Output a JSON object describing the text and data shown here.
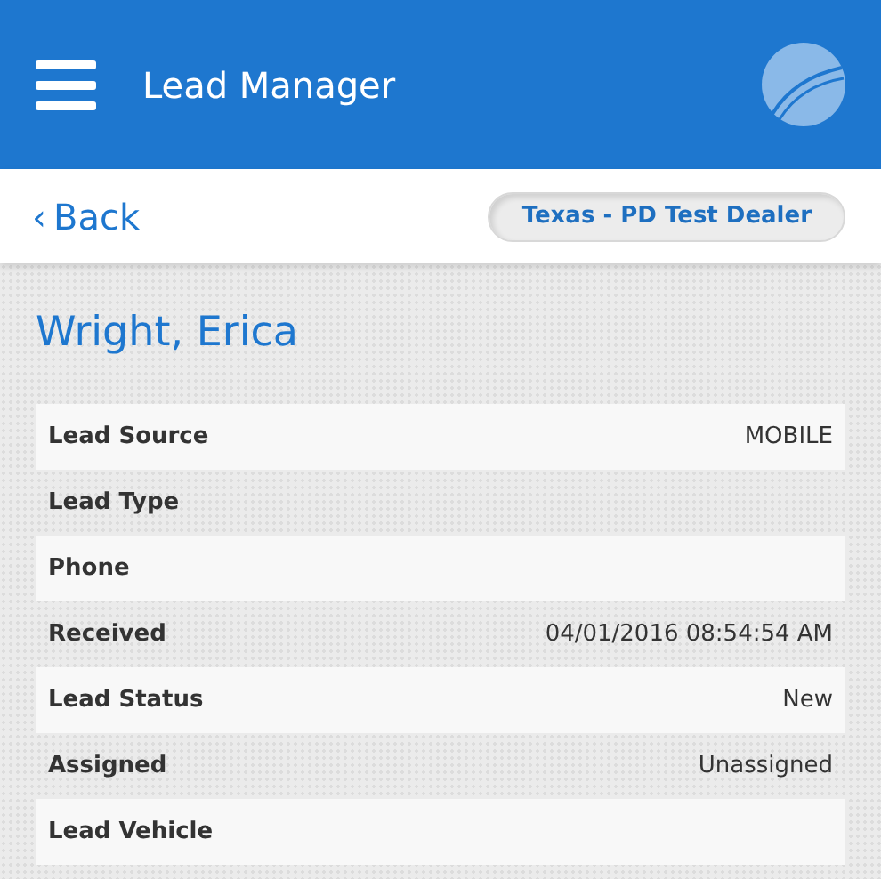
{
  "header": {
    "title": "Lead Manager"
  },
  "subbar": {
    "back": "Back",
    "back_arrow": "‹",
    "dealer": "Texas - PD Test Dealer"
  },
  "lead": {
    "name": "Wright, Erica",
    "fields": [
      {
        "label": "Lead Source",
        "value": "MOBILE"
      },
      {
        "label": "Lead Type"
      },
      {
        "label": "Phone"
      },
      {
        "label": "Received",
        "value": "04/01/2016 08:54:54 AM"
      },
      {
        "label": "Lead Status",
        "value": "New"
      },
      {
        "label": "Assigned",
        "value": "Unassigned"
      },
      {
        "label": "Lead Vehicle"
      }
    ]
  }
}
